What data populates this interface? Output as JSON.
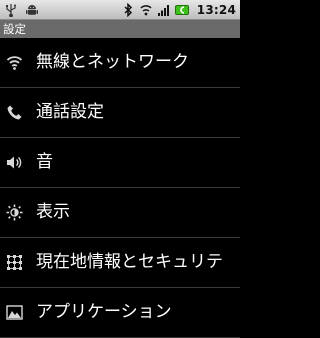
{
  "status_bar": {
    "time": "13:24",
    "left_icons": [
      "usb-icon",
      "android-icon"
    ],
    "right_icons": [
      "bluetooth-icon",
      "wifi-icon",
      "signal-icon",
      "battery-icon"
    ],
    "battery_color": "#3ec01b"
  },
  "title_bar": {
    "title": "設定"
  },
  "settings": {
    "items": [
      {
        "label": "無線とネットワーク",
        "icon": "wireless-icon"
      },
      {
        "label": "通話設定",
        "icon": "phone-icon"
      },
      {
        "label": "音",
        "icon": "speaker-icon"
      },
      {
        "label": "表示",
        "icon": "brightness-icon"
      },
      {
        "label": "現在地情報とセキュリテ",
        "icon": "location-security-icon"
      },
      {
        "label": "アプリケーション",
        "icon": "applications-icon"
      }
    ]
  }
}
